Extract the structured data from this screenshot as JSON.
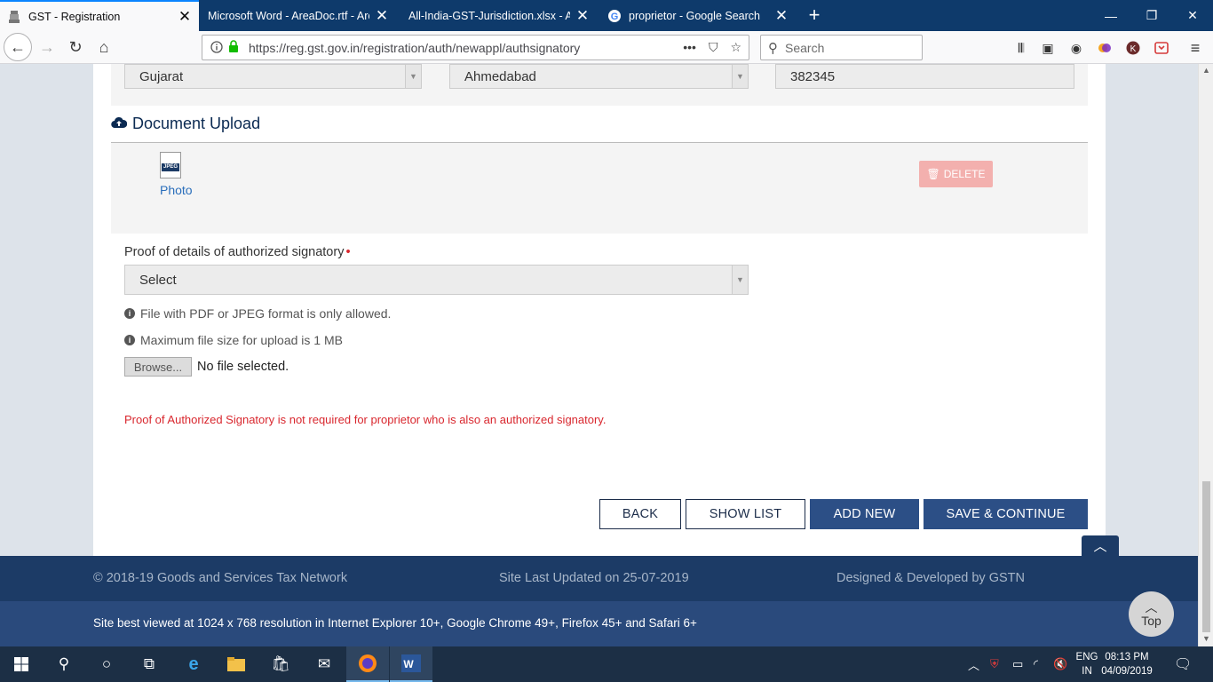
{
  "browser": {
    "tabs": [
      {
        "title": "GST - Registration",
        "active": true
      },
      {
        "title": "Microsoft Word - AreaDoc.rtf - Are",
        "active": false
      },
      {
        "title": "All-India-GST-Jurisdiction.xlsx - All",
        "active": false
      },
      {
        "title": "proprietor - Google Search",
        "active": false
      }
    ],
    "url": "https://reg.gst.gov.in/registration/auth/newappl/authsignatory",
    "search_placeholder": "Search",
    "url_actions": [
      "more-icon",
      "pocket-icon",
      "bookmark-star-icon"
    ],
    "toolbar_icons": [
      "library-icon",
      "sidebar-icon",
      "account-icon",
      "extension-icon",
      "profile-k-icon",
      "pocket-icon",
      "menu-icon"
    ]
  },
  "address": {
    "state": "Gujarat",
    "district": "Ahmedabad",
    "pin": "382345"
  },
  "document_upload": {
    "title": "Document Upload",
    "file_type_badge": "JPEG",
    "photo_label": "Photo",
    "delete_label": "DELETE"
  },
  "proof": {
    "label": "Proof of details of authorized signatory",
    "required_mark": "•",
    "select_value": "Select",
    "info_format": "File with PDF or JPEG format is only allowed.",
    "info_size": "Maximum file size for upload is 1 MB",
    "browse_label": "Browse...",
    "no_file": "No file selected.",
    "warning": "Proof of Authorized Signatory is not required for proprietor who is also an authorized signatory."
  },
  "actions": {
    "back": "BACK",
    "show_list": "SHOW LIST",
    "add_new": "ADD NEW",
    "save_continue": "SAVE & CONTINUE"
  },
  "footer": {
    "copyright": "© 2018-19 Goods and Services Tax Network",
    "updated": "Site Last Updated on 25-07-2019",
    "designed": "Designed & Developed by GSTN",
    "best_viewed": "Site best viewed at 1024 x 768 resolution in Internet Explorer 10+, Google Chrome 49+, Firefox 45+ and Safari 6+",
    "top_label": "Top"
  },
  "taskbar": {
    "language_line1": "ENG",
    "language_line2": "IN",
    "time": "08:13 PM",
    "date": "04/09/2019"
  },
  "colors": {
    "header_navy": "#1c3b66",
    "button_blue": "#2c4f86",
    "required_red": "#d9272e",
    "link_blue": "#2a6ebb"
  }
}
